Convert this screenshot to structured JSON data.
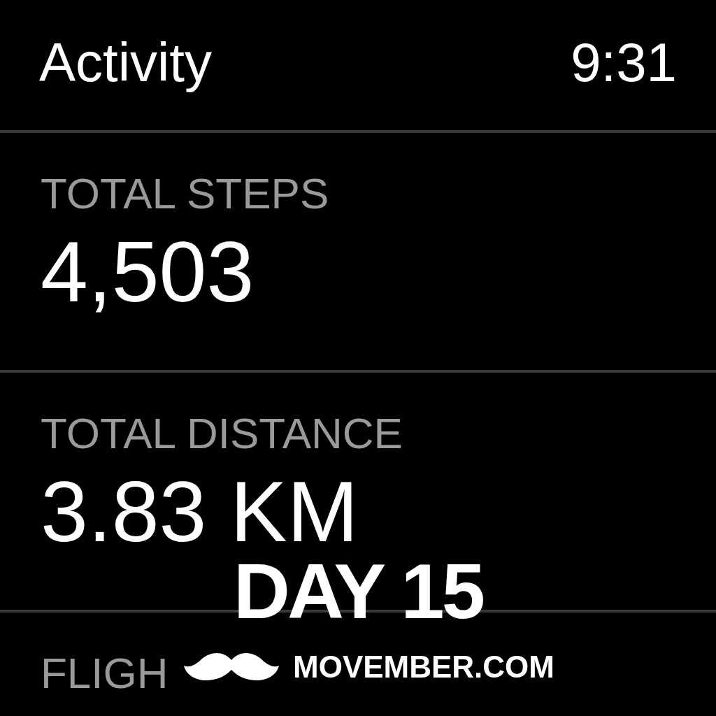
{
  "header": {
    "title": "Activity",
    "time": "9:31"
  },
  "metrics": [
    {
      "label": "TOTAL STEPS",
      "value": "4,503"
    },
    {
      "label": "TOTAL DISTANCE",
      "value": "3.83 KM"
    },
    {
      "label": "FLIGH"
    }
  ],
  "overlay": {
    "day": "DAY 15",
    "site": "MOVEMBER.COM"
  }
}
